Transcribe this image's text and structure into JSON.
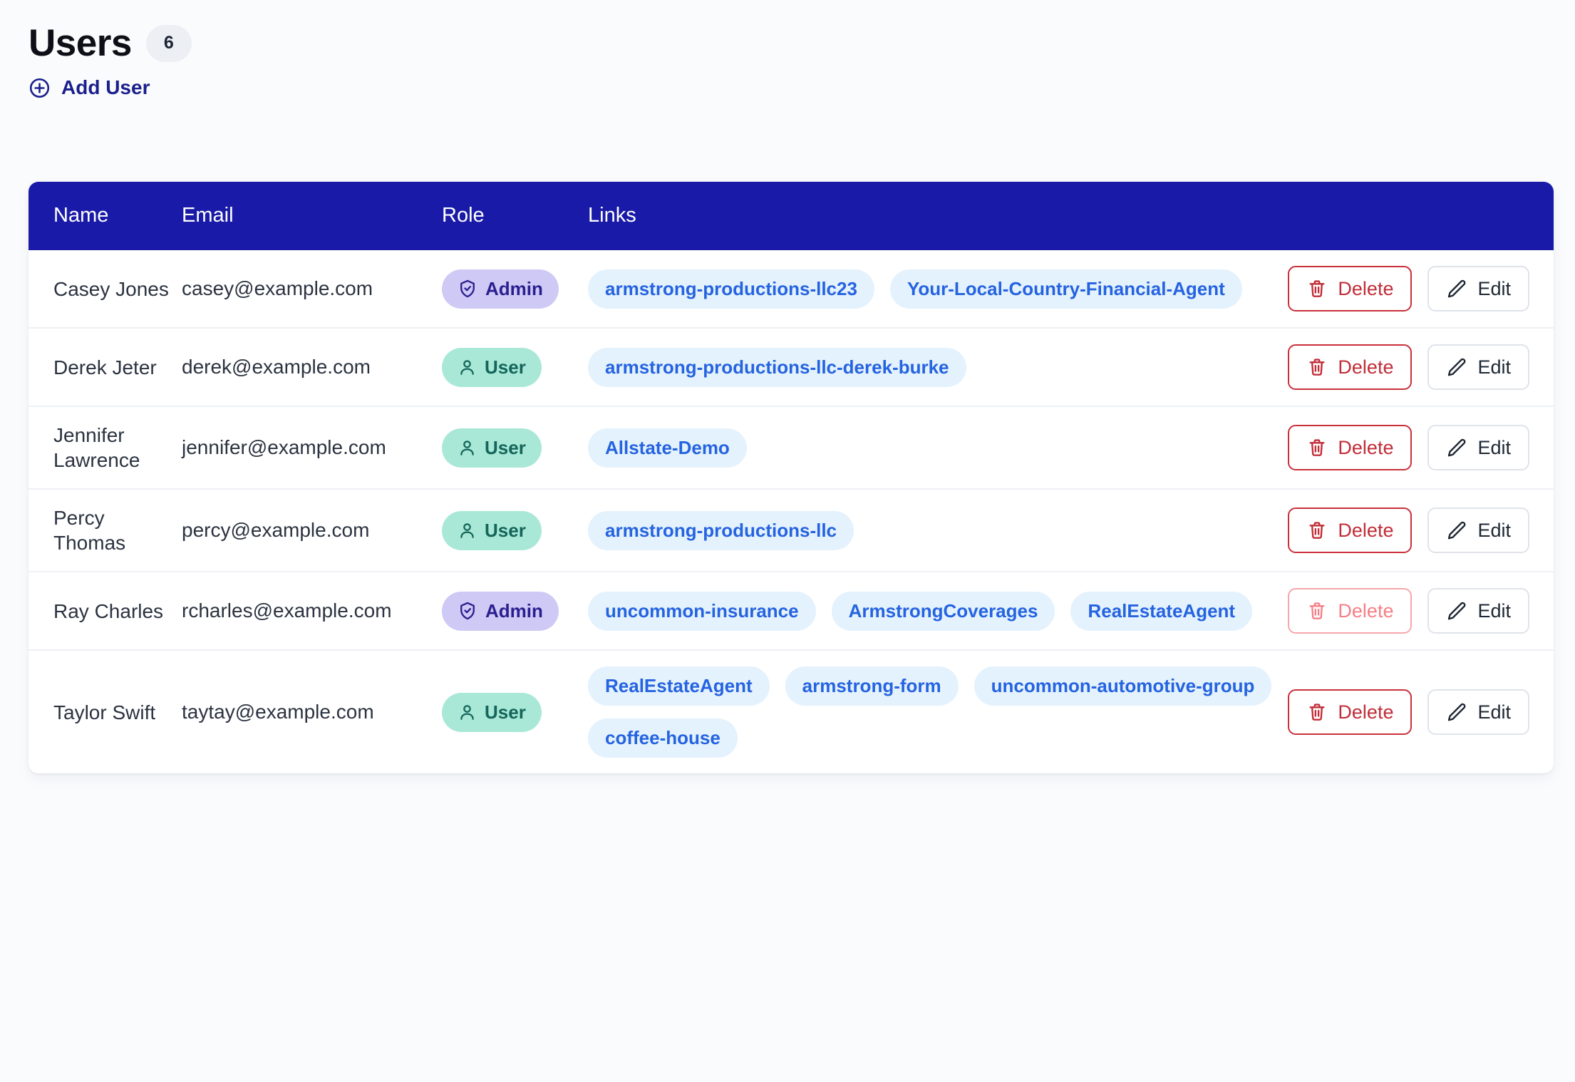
{
  "header": {
    "title": "Users",
    "count": "6",
    "add_user_label": "Add User",
    "add_user_icon": "plus-circle-icon"
  },
  "table": {
    "columns": [
      "Name",
      "Email",
      "Role",
      "Links",
      ""
    ],
    "rows": [
      {
        "name": "Casey Jones",
        "email": "casey@example.com",
        "role": "Admin",
        "role_type": "admin",
        "role_icon": "shield-check-icon",
        "links": [
          "armstrong-productions-llc23",
          "Your-Local-Country-Financial-Agent"
        ],
        "delete_label": "Delete",
        "edit_label": "Edit",
        "delete_disabled": false
      },
      {
        "name": "Derek Jeter",
        "email": "derek@example.com",
        "role": "User",
        "role_type": "user",
        "role_icon": "person-icon",
        "links": [
          "armstrong-productions-llc-derek-burke"
        ],
        "delete_label": "Delete",
        "edit_label": "Edit",
        "delete_disabled": false
      },
      {
        "name": "Jennifer Lawrence",
        "email": "jennifer@example.com",
        "role": "User",
        "role_type": "user",
        "role_icon": "person-icon",
        "links": [
          "Allstate-Demo"
        ],
        "delete_label": "Delete",
        "edit_label": "Edit",
        "delete_disabled": false
      },
      {
        "name": "Percy Thomas",
        "email": "percy@example.com",
        "role": "User",
        "role_type": "user",
        "role_icon": "person-icon",
        "links": [
          "armstrong-productions-llc"
        ],
        "delete_label": "Delete",
        "edit_label": "Edit",
        "delete_disabled": false
      },
      {
        "name": "Ray Charles",
        "email": "rcharles@example.com",
        "role": "Admin",
        "role_type": "admin",
        "role_icon": "shield-check-icon",
        "links": [
          "uncommon-insurance",
          "ArmstrongCoverages",
          "RealEstateAgent"
        ],
        "delete_label": "Delete",
        "edit_label": "Edit",
        "delete_disabled": true
      },
      {
        "name": "Taylor Swift",
        "email": "taytay@example.com",
        "role": "User",
        "role_type": "user",
        "role_icon": "person-icon",
        "links": [
          "RealEstateAgent",
          "armstrong-form",
          "uncommon-automotive-group",
          "coffee-house"
        ],
        "delete_label": "Delete",
        "edit_label": "Edit",
        "delete_disabled": false
      }
    ]
  },
  "icons": {
    "delete": "trash-icon",
    "edit": "pencil-icon"
  },
  "colors": {
    "header_bar": "#1a1aa8",
    "accent_link": "#1a1f8c",
    "pill_bg": "#e4f2fd",
    "pill_text": "#2563e0",
    "admin_badge_bg": "#cec9f5",
    "admin_badge_text": "#2a1f8f",
    "user_badge_bg": "#a9e8d7",
    "user_badge_text": "#14655a",
    "delete_border": "#c9303b",
    "delete_text": "#c12d38",
    "page_bg": "#fafbfd"
  }
}
